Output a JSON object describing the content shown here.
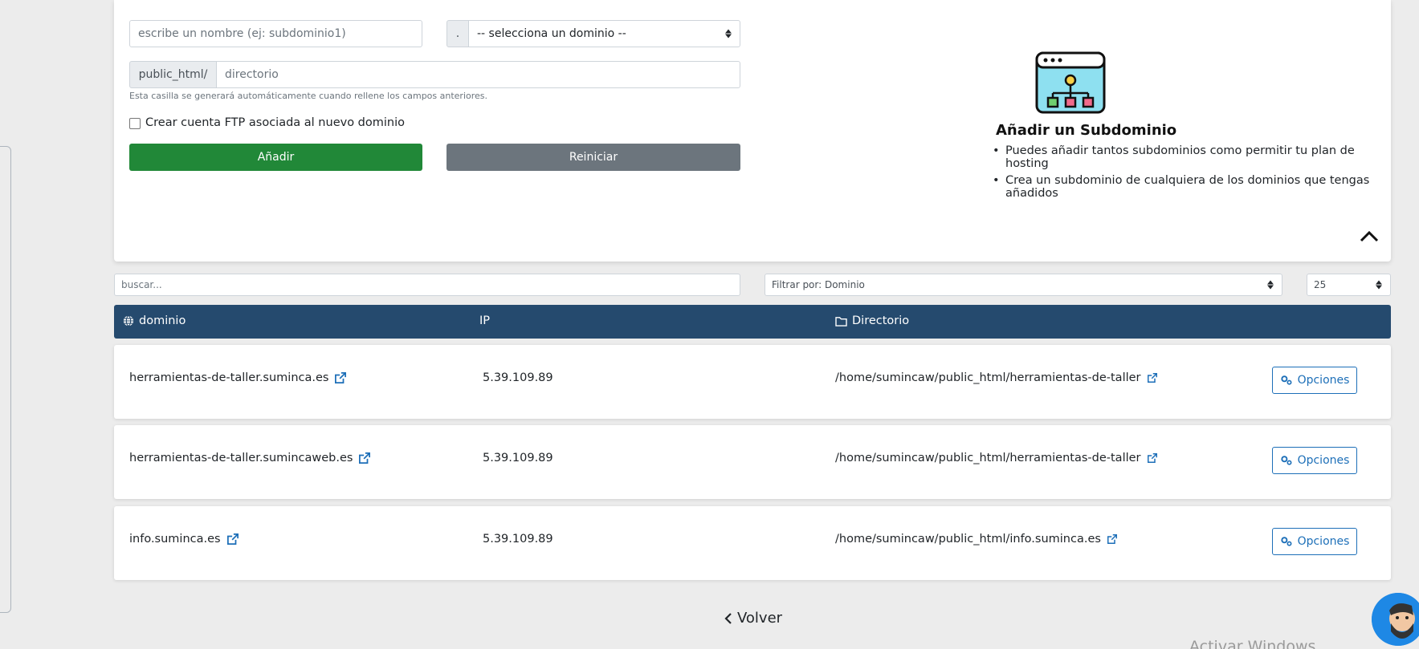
{
  "form": {
    "name_placeholder": "escribe un nombre (ej: subdominio1)",
    "dot_label": ".",
    "domain_select_value": "-- selecciona un dominio --",
    "dir_prefix": "public_html/",
    "dir_placeholder": "directorio",
    "hint": "Esta casilla se generará automáticamente cuando rellene los campos anteriores.",
    "ftp_checkbox_label": "Crear cuenta FTP asociada al nuevo dominio",
    "add_button": "Añadir",
    "reset_button": "Reiniciar"
  },
  "info": {
    "title": "Añadir un Subdominio",
    "bullets": [
      "Puedes añadir tantos subdominios como permitir tu plan de hosting",
      "Crea un subdominio de cualquiera de los dominios que tengas añadidos"
    ]
  },
  "filters": {
    "search_placeholder": "buscar...",
    "filter_value": "Filtrar por: Dominio",
    "page_size": "25"
  },
  "table": {
    "headers": {
      "domain": "dominio",
      "ip": "IP",
      "directory": "Directorio"
    },
    "rows": [
      {
        "domain": "herramientas-de-taller.suminca.es",
        "ip": "5.39.109.89",
        "directory": "/home/sumincaw/public_html/herramientas-de-taller",
        "action": "Opciones"
      },
      {
        "domain": "herramientas-de-taller.sumincaweb.es",
        "ip": "5.39.109.89",
        "directory": "/home/sumincaw/public_html/herramientas-de-taller",
        "action": "Opciones"
      },
      {
        "domain": "info.suminca.es",
        "ip": "5.39.109.89",
        "directory": "/home/sumincaw/public_html/info.suminca.es",
        "action": "Opciones"
      }
    ]
  },
  "footer": {
    "back_label": "Volver",
    "watermark": "Activar Windows"
  },
  "colors": {
    "header_bg": "#254a6e",
    "add_button": "#218838",
    "reset_button": "#6c757d",
    "link": "#1d6fb8"
  },
  "icons": [
    "subdomain-illustration-icon",
    "chevron-up-icon",
    "globe-icon",
    "folder-icon",
    "external-link-icon",
    "cogs-icon",
    "chevron-left-icon",
    "chat-avatar"
  ]
}
